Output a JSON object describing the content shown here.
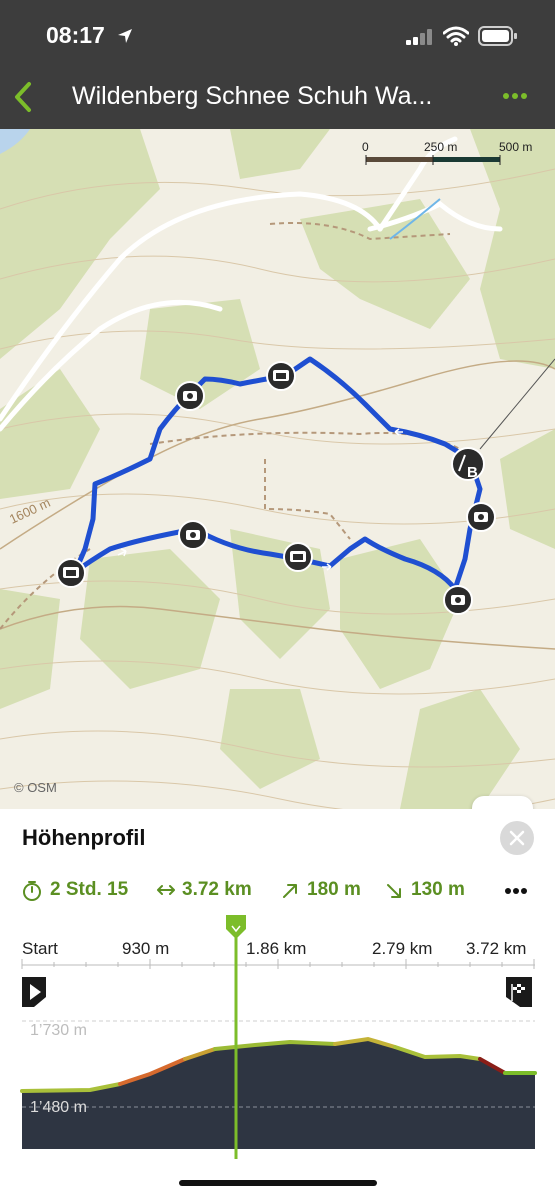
{
  "status_bar": {
    "time": "08:17"
  },
  "header": {
    "title": "Wildenberg Schnee Schuh Wa..."
  },
  "map": {
    "scale_labels": [
      "0",
      "250 m",
      "500 m"
    ],
    "contour_label": "1600 m",
    "attribution": "© OSM",
    "route_color": "#1f4fd1",
    "end_marker_label": "B"
  },
  "profile": {
    "title": "Höhenprofil",
    "duration": "2 Std. 15",
    "distance": "3.72 km",
    "ascent": "180 m",
    "descent": "130 m",
    "axis_labels": [
      "Start",
      "930 m",
      "1.86 km",
      "2.79 km",
      "3.72 km"
    ],
    "elevation_high": "1’730 m",
    "elevation_low": "1’480 m",
    "accent_color": "#7cbd2a"
  }
}
